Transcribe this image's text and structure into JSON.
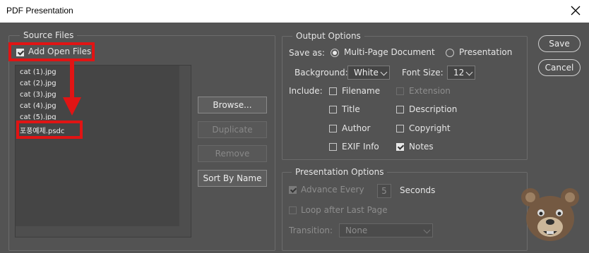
{
  "window": {
    "title": "PDF Presentation",
    "close_icon": "close-icon"
  },
  "source_files": {
    "legend": "Source Files",
    "add_open_files": {
      "label": "Add Open Files",
      "checked": true
    },
    "files": [
      "cat (1).jpg",
      "cat (2).jpg",
      "cat (3).jpg",
      "cat (4).jpg",
      "cat (5).jpg"
    ],
    "highlighted_file": "포풍예제.psdc",
    "buttons": {
      "browse": "Browse...",
      "duplicate": "Duplicate",
      "remove": "Remove",
      "sort": "Sort By Name"
    }
  },
  "output_options": {
    "legend": "Output Options",
    "save_as_label": "Save as:",
    "save_as_options": [
      {
        "label": "Multi-Page Document",
        "selected": true
      },
      {
        "label": "Presentation",
        "selected": false
      }
    ],
    "background_label": "Background:",
    "background_value": "White",
    "font_size_label": "Font Size:",
    "font_size_value": "12",
    "include_label": "Include:",
    "include": {
      "filename": {
        "label": "Filename",
        "checked": false
      },
      "extension": {
        "label": "Extension",
        "checked": false,
        "disabled": true
      },
      "title": {
        "label": "Title",
        "checked": false
      },
      "description": {
        "label": "Description",
        "checked": false
      },
      "author": {
        "label": "Author",
        "checked": false
      },
      "copyright": {
        "label": "Copyright",
        "checked": false
      },
      "exif": {
        "label": "EXIF Info",
        "checked": false
      },
      "notes": {
        "label": "Notes",
        "checked": true
      }
    }
  },
  "presentation_options": {
    "legend": "Presentation Options",
    "advance_every": {
      "label": "Advance Every",
      "value": "5",
      "unit": "Seconds",
      "checked": true,
      "disabled": true
    },
    "loop": {
      "label": "Loop after Last Page",
      "checked": false,
      "disabled": true
    },
    "transition_label": "Transition:",
    "transition_value": "None"
  },
  "actions": {
    "save": "Save",
    "cancel": "Cancel"
  },
  "colors": {
    "dialog_bg": "#535353",
    "highlight": "#e11414"
  }
}
